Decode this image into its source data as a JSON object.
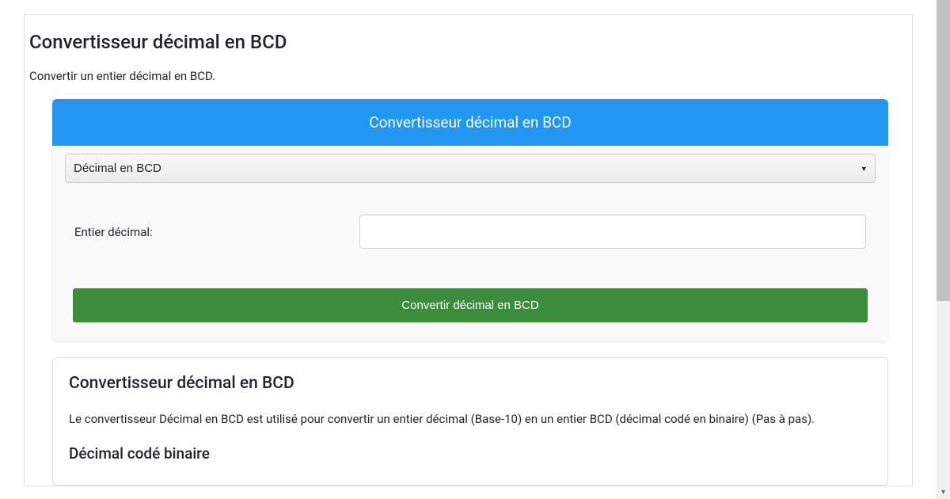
{
  "page": {
    "title": "Convertisseur décimal en BCD",
    "subtitle": "Convertir un entier décimal en BCD."
  },
  "card": {
    "header": "Convertisseur décimal en BCD",
    "mode_selected": "Décimal en BCD",
    "input_label": "Entier décimal:",
    "input_value": "",
    "button_label": "Convertir décimal en BCD"
  },
  "info": {
    "title": "Convertisseur décimal en BCD",
    "description": "Le convertisseur Décimal en BCD est utilisé pour convertir un entier décimal (Base-10) en un entier BCD (décimal codé en binaire) (Pas à pas).",
    "subtitle": "Décimal codé binaire"
  }
}
